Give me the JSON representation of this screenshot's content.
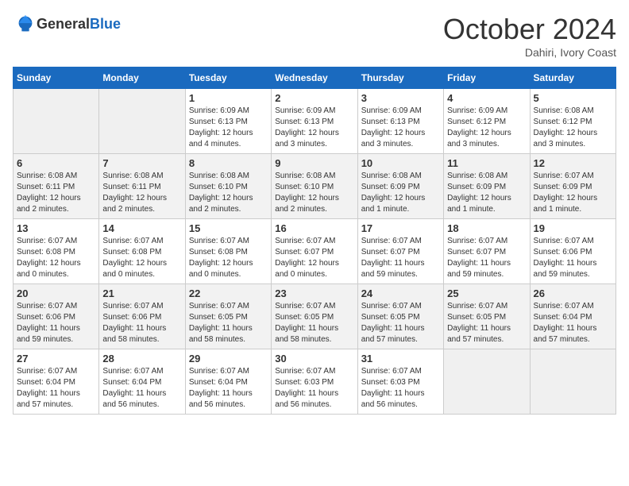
{
  "header": {
    "logo_general": "General",
    "logo_blue": "Blue",
    "month": "October 2024",
    "location": "Dahiri, Ivory Coast"
  },
  "weekdays": [
    "Sunday",
    "Monday",
    "Tuesday",
    "Wednesday",
    "Thursday",
    "Friday",
    "Saturday"
  ],
  "weeks": [
    [
      {
        "day": "",
        "detail": ""
      },
      {
        "day": "",
        "detail": ""
      },
      {
        "day": "1",
        "detail": "Sunrise: 6:09 AM\nSunset: 6:13 PM\nDaylight: 12 hours\nand 4 minutes."
      },
      {
        "day": "2",
        "detail": "Sunrise: 6:09 AM\nSunset: 6:13 PM\nDaylight: 12 hours\nand 3 minutes."
      },
      {
        "day": "3",
        "detail": "Sunrise: 6:09 AM\nSunset: 6:13 PM\nDaylight: 12 hours\nand 3 minutes."
      },
      {
        "day": "4",
        "detail": "Sunrise: 6:09 AM\nSunset: 6:12 PM\nDaylight: 12 hours\nand 3 minutes."
      },
      {
        "day": "5",
        "detail": "Sunrise: 6:08 AM\nSunset: 6:12 PM\nDaylight: 12 hours\nand 3 minutes."
      }
    ],
    [
      {
        "day": "6",
        "detail": "Sunrise: 6:08 AM\nSunset: 6:11 PM\nDaylight: 12 hours\nand 2 minutes."
      },
      {
        "day": "7",
        "detail": "Sunrise: 6:08 AM\nSunset: 6:11 PM\nDaylight: 12 hours\nand 2 minutes."
      },
      {
        "day": "8",
        "detail": "Sunrise: 6:08 AM\nSunset: 6:10 PM\nDaylight: 12 hours\nand 2 minutes."
      },
      {
        "day": "9",
        "detail": "Sunrise: 6:08 AM\nSunset: 6:10 PM\nDaylight: 12 hours\nand 2 minutes."
      },
      {
        "day": "10",
        "detail": "Sunrise: 6:08 AM\nSunset: 6:09 PM\nDaylight: 12 hours\nand 1 minute."
      },
      {
        "day": "11",
        "detail": "Sunrise: 6:08 AM\nSunset: 6:09 PM\nDaylight: 12 hours\nand 1 minute."
      },
      {
        "day": "12",
        "detail": "Sunrise: 6:07 AM\nSunset: 6:09 PM\nDaylight: 12 hours\nand 1 minute."
      }
    ],
    [
      {
        "day": "13",
        "detail": "Sunrise: 6:07 AM\nSunset: 6:08 PM\nDaylight: 12 hours\nand 0 minutes."
      },
      {
        "day": "14",
        "detail": "Sunrise: 6:07 AM\nSunset: 6:08 PM\nDaylight: 12 hours\nand 0 minutes."
      },
      {
        "day": "15",
        "detail": "Sunrise: 6:07 AM\nSunset: 6:08 PM\nDaylight: 12 hours\nand 0 minutes."
      },
      {
        "day": "16",
        "detail": "Sunrise: 6:07 AM\nSunset: 6:07 PM\nDaylight: 12 hours\nand 0 minutes."
      },
      {
        "day": "17",
        "detail": "Sunrise: 6:07 AM\nSunset: 6:07 PM\nDaylight: 11 hours\nand 59 minutes."
      },
      {
        "day": "18",
        "detail": "Sunrise: 6:07 AM\nSunset: 6:07 PM\nDaylight: 11 hours\nand 59 minutes."
      },
      {
        "day": "19",
        "detail": "Sunrise: 6:07 AM\nSunset: 6:06 PM\nDaylight: 11 hours\nand 59 minutes."
      }
    ],
    [
      {
        "day": "20",
        "detail": "Sunrise: 6:07 AM\nSunset: 6:06 PM\nDaylight: 11 hours\nand 59 minutes."
      },
      {
        "day": "21",
        "detail": "Sunrise: 6:07 AM\nSunset: 6:06 PM\nDaylight: 11 hours\nand 58 minutes."
      },
      {
        "day": "22",
        "detail": "Sunrise: 6:07 AM\nSunset: 6:05 PM\nDaylight: 11 hours\nand 58 minutes."
      },
      {
        "day": "23",
        "detail": "Sunrise: 6:07 AM\nSunset: 6:05 PM\nDaylight: 11 hours\nand 58 minutes."
      },
      {
        "day": "24",
        "detail": "Sunrise: 6:07 AM\nSunset: 6:05 PM\nDaylight: 11 hours\nand 57 minutes."
      },
      {
        "day": "25",
        "detail": "Sunrise: 6:07 AM\nSunset: 6:05 PM\nDaylight: 11 hours\nand 57 minutes."
      },
      {
        "day": "26",
        "detail": "Sunrise: 6:07 AM\nSunset: 6:04 PM\nDaylight: 11 hours\nand 57 minutes."
      }
    ],
    [
      {
        "day": "27",
        "detail": "Sunrise: 6:07 AM\nSunset: 6:04 PM\nDaylight: 11 hours\nand 57 minutes."
      },
      {
        "day": "28",
        "detail": "Sunrise: 6:07 AM\nSunset: 6:04 PM\nDaylight: 11 hours\nand 56 minutes."
      },
      {
        "day": "29",
        "detail": "Sunrise: 6:07 AM\nSunset: 6:04 PM\nDaylight: 11 hours\nand 56 minutes."
      },
      {
        "day": "30",
        "detail": "Sunrise: 6:07 AM\nSunset: 6:03 PM\nDaylight: 11 hours\nand 56 minutes."
      },
      {
        "day": "31",
        "detail": "Sunrise: 6:07 AM\nSunset: 6:03 PM\nDaylight: 11 hours\nand 56 minutes."
      },
      {
        "day": "",
        "detail": ""
      },
      {
        "day": "",
        "detail": ""
      }
    ]
  ]
}
